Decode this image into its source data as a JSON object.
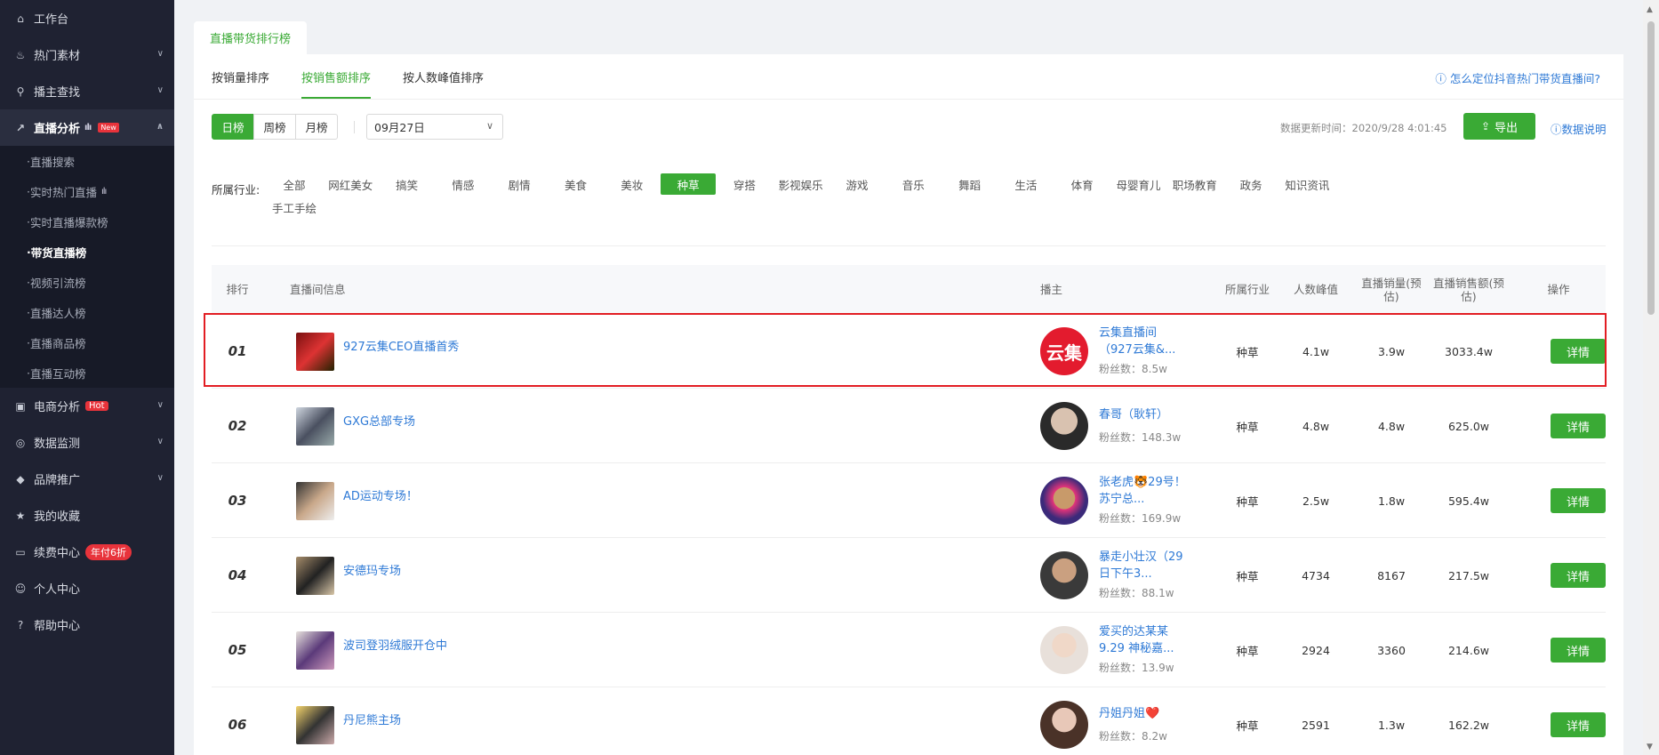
{
  "sidebar": {
    "items": [
      {
        "label": "工作台",
        "icon": "home-icon",
        "glyph": "⌂"
      },
      {
        "label": "热门素材",
        "icon": "fire-icon",
        "glyph": "♨"
      },
      {
        "label": "播主查找",
        "icon": "search-icon",
        "glyph": "⚲"
      },
      {
        "label": "直播分析",
        "icon": "chart-icon",
        "glyph": "↗",
        "badge": "New"
      },
      {
        "label": "电商分析",
        "icon": "bag-icon",
        "glyph": "▣",
        "badge": "Hot"
      },
      {
        "label": "数据监测",
        "icon": "monitor-icon",
        "glyph": "◎"
      },
      {
        "label": "品牌推广",
        "icon": "diamond-icon",
        "glyph": "◆"
      },
      {
        "label": "我的收藏",
        "icon": "star-icon",
        "glyph": "★"
      },
      {
        "label": "续费中心",
        "icon": "card-icon",
        "glyph": "▭",
        "badge": "年付6折"
      },
      {
        "label": "个人中心",
        "icon": "user-icon",
        "glyph": "☺"
      },
      {
        "label": "帮助中心",
        "icon": "help-icon",
        "glyph": "?"
      }
    ],
    "sub_items": [
      "直播搜索",
      "实时热门直播",
      "实时直播爆款榜",
      "带货直播榜",
      "视频引流榜",
      "直播达人榜",
      "直播商品榜",
      "直播互动榜"
    ]
  },
  "top_tab": "直播带货排行榜",
  "sort_tabs": [
    "按销量排序",
    "按销售额排序",
    "按人数峰值排序"
  ],
  "help_link": "ⓘ 怎么定位抖音热门带货直播间?",
  "period": {
    "buttons": [
      "日榜",
      "周榜",
      "月榜"
    ],
    "date": "09月27日"
  },
  "update_time": "数据更新时间：2020/9/28 4:01:45",
  "export_label": "导出",
  "data_note": "ⓘ数据说明",
  "industry": {
    "label": "所属行业:",
    "options": [
      "全部",
      "网红美女",
      "搞笑",
      "情感",
      "剧情",
      "美食",
      "美妆",
      "种草",
      "穿搭",
      "影视娱乐",
      "游戏",
      "音乐",
      "舞蹈",
      "生活",
      "体育",
      "母婴育儿",
      "职场教育",
      "政务",
      "知识资讯",
      "手工手绘"
    ],
    "selected": "种草"
  },
  "table": {
    "headers": {
      "rank": "排行",
      "room": "直播间信息",
      "host": "播主",
      "industry": "所属行业",
      "peak": "人数峰值",
      "volume": "直播销量(预估)",
      "amount": "直播销售额(预估)",
      "action": "操作"
    },
    "detail_label": "详情",
    "rows": [
      {
        "rank": "01",
        "title": "927云集CEO直播首秀",
        "host": "云集直播间（927云集&...",
        "fans": "粉丝数：8.5w",
        "industry": "种草",
        "peak": "4.1w",
        "volume": "3.9w",
        "amount": "3033.4w",
        "avatar_text": "云集"
      },
      {
        "rank": "02",
        "title": "GXG总部专场",
        "host": "春哥（耿轩）",
        "fans": "粉丝数：148.3w",
        "industry": "种草",
        "peak": "4.8w",
        "volume": "4.8w",
        "amount": "625.0w"
      },
      {
        "rank": "03",
        "title": "AD运动专场！",
        "host": "张老虎🐯29号！苏宁总...",
        "fans": "粉丝数：169.9w",
        "industry": "种草",
        "peak": "2.5w",
        "volume": "1.8w",
        "amount": "595.4w"
      },
      {
        "rank": "04",
        "title": "安德玛专场",
        "host": "暴走小壮汉（29日下午3...",
        "fans": "粉丝数：88.1w",
        "industry": "种草",
        "peak": "4734",
        "volume": "8167",
        "amount": "217.5w"
      },
      {
        "rank": "05",
        "title": "波司登羽绒服开仓中",
        "host": "爱买的达某某9.29 神秘嘉...",
        "fans": "粉丝数：13.9w",
        "industry": "种草",
        "peak": "2924",
        "volume": "3360",
        "amount": "214.6w"
      },
      {
        "rank": "06",
        "title": "丹尼熊主场",
        "host": "丹姐丹姐❤️",
        "fans": "粉丝数：8.2w",
        "industry": "种草",
        "peak": "2591",
        "volume": "1.3w",
        "amount": "162.2w"
      }
    ]
  },
  "colors": {
    "accent": "#3aaa35",
    "link": "#2f7ad6",
    "sidebar_bg": "#1f2232",
    "highlight": "#e21d23"
  }
}
